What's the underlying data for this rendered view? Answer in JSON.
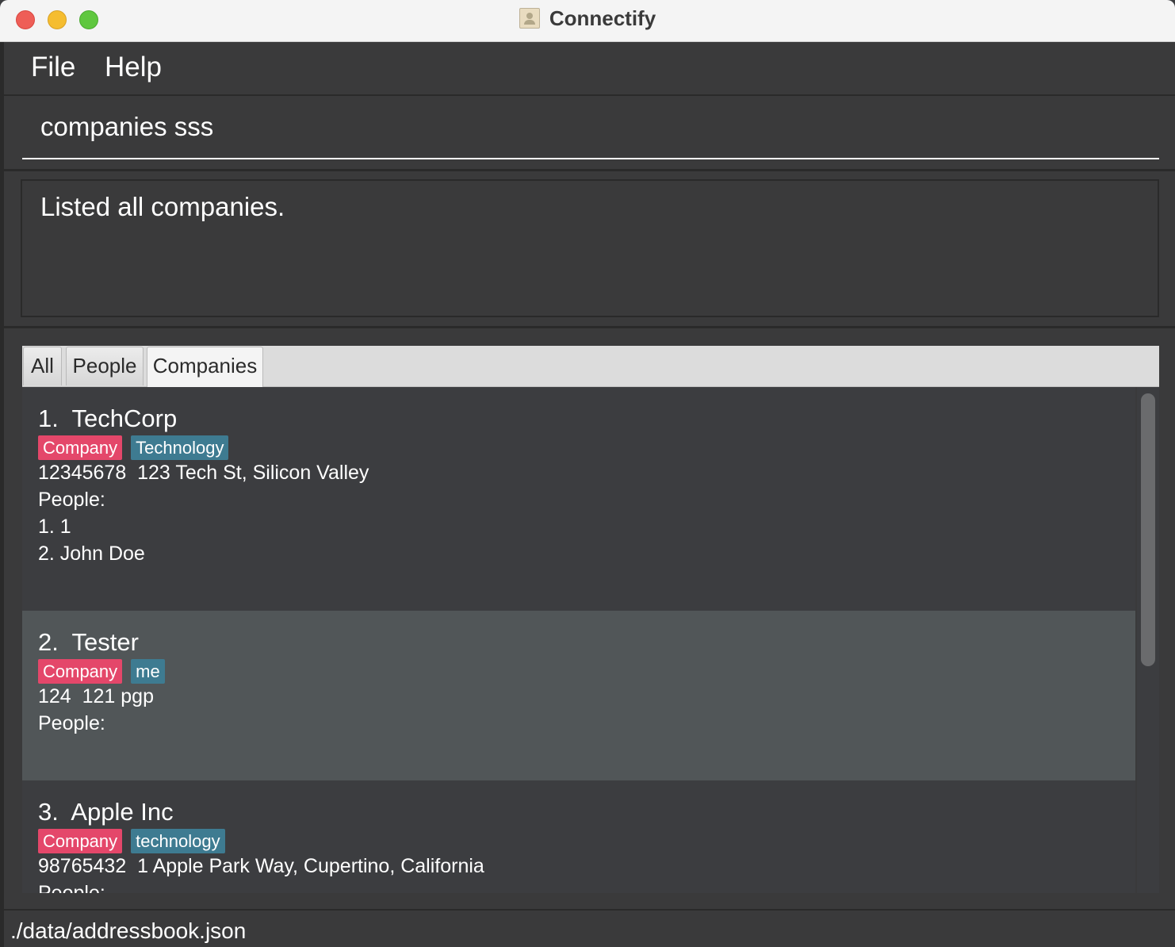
{
  "window": {
    "title": "Connectify"
  },
  "menu": {
    "file": "File",
    "help": "Help"
  },
  "command": {
    "value": "companies sss"
  },
  "result": {
    "message": "Listed all companies."
  },
  "tabs": [
    {
      "label": "All",
      "selected": false
    },
    {
      "label": "People",
      "selected": false
    },
    {
      "label": "Companies",
      "selected": true
    }
  ],
  "companies": [
    {
      "title": "1.  TechCorp",
      "tags": [
        "Company",
        "Technology"
      ],
      "details": "12345678  123 Tech St, Silicon Valley",
      "people_label": "People:",
      "people": [
        "1. 1",
        "2. John Doe"
      ]
    },
    {
      "title": "2.  Tester",
      "tags": [
        "Company",
        "me"
      ],
      "details": "124  121 pgp",
      "people_label": "People:",
      "people": []
    },
    {
      "title": "3.  Apple Inc",
      "tags": [
        "Company",
        "technology"
      ],
      "details": "98765432  1 Apple Park Way, Cupertino, California",
      "people_label": "People:",
      "people": []
    }
  ],
  "status": {
    "file_path": "./data/addressbook.json"
  },
  "colors": {
    "company_tag": "#e4476a",
    "topic_tag": "#3e7b91",
    "card_alt": "#515658",
    "background": "#3c3d40"
  }
}
